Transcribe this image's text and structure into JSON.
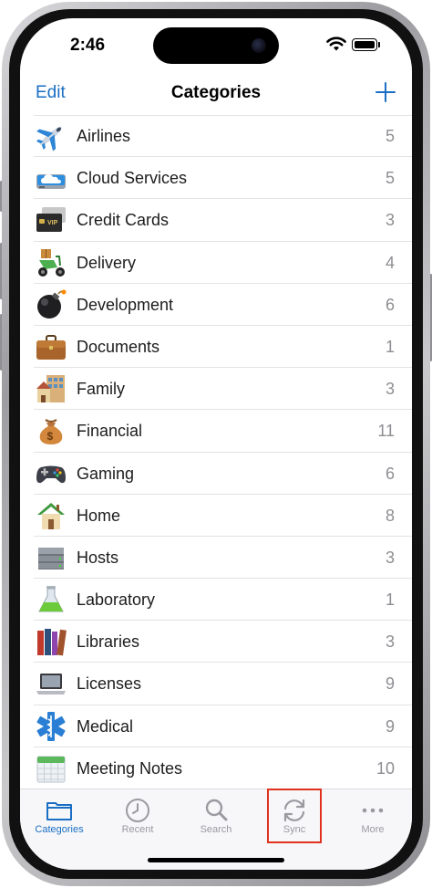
{
  "status": {
    "time": "2:46"
  },
  "nav": {
    "edit_label": "Edit",
    "title": "Categories"
  },
  "categories": [
    {
      "label": "Airlines",
      "count": "5",
      "icon": "airplane-icon"
    },
    {
      "label": "Cloud Services",
      "count": "5",
      "icon": "cloud-drive-icon"
    },
    {
      "label": "Credit Cards",
      "count": "3",
      "icon": "credit-card-icon"
    },
    {
      "label": "Delivery",
      "count": "4",
      "icon": "scooter-icon"
    },
    {
      "label": "Development",
      "count": "6",
      "icon": "bomb-icon"
    },
    {
      "label": "Documents",
      "count": "1",
      "icon": "briefcase-icon"
    },
    {
      "label": "Family",
      "count": "3",
      "icon": "house-building-icon"
    },
    {
      "label": "Financial",
      "count": "11",
      "icon": "money-bag-icon"
    },
    {
      "label": "Gaming",
      "count": "6",
      "icon": "gamepad-icon"
    },
    {
      "label": "Home",
      "count": "8",
      "icon": "home-icon"
    },
    {
      "label": "Hosts",
      "count": "3",
      "icon": "server-icon"
    },
    {
      "label": "Laboratory",
      "count": "1",
      "icon": "flask-icon"
    },
    {
      "label": "Libraries",
      "count": "3",
      "icon": "books-icon"
    },
    {
      "label": "Licenses",
      "count": "9",
      "icon": "laptop-icon"
    },
    {
      "label": "Medical",
      "count": "9",
      "icon": "medical-star-icon"
    },
    {
      "label": "Meeting Notes",
      "count": "10",
      "icon": "calendar-icon"
    }
  ],
  "tabs": [
    {
      "label": "Categories",
      "icon": "folder-icon",
      "active": true
    },
    {
      "label": "Recent",
      "icon": "clock-icon",
      "active": false
    },
    {
      "label": "Search",
      "icon": "search-icon",
      "active": false
    },
    {
      "label": "Sync",
      "icon": "sync-icon",
      "active": false
    },
    {
      "label": "More",
      "icon": "more-dots-icon",
      "active": false
    }
  ],
  "colors": {
    "accent": "#1a6fc4",
    "highlight": "#e0331f"
  }
}
